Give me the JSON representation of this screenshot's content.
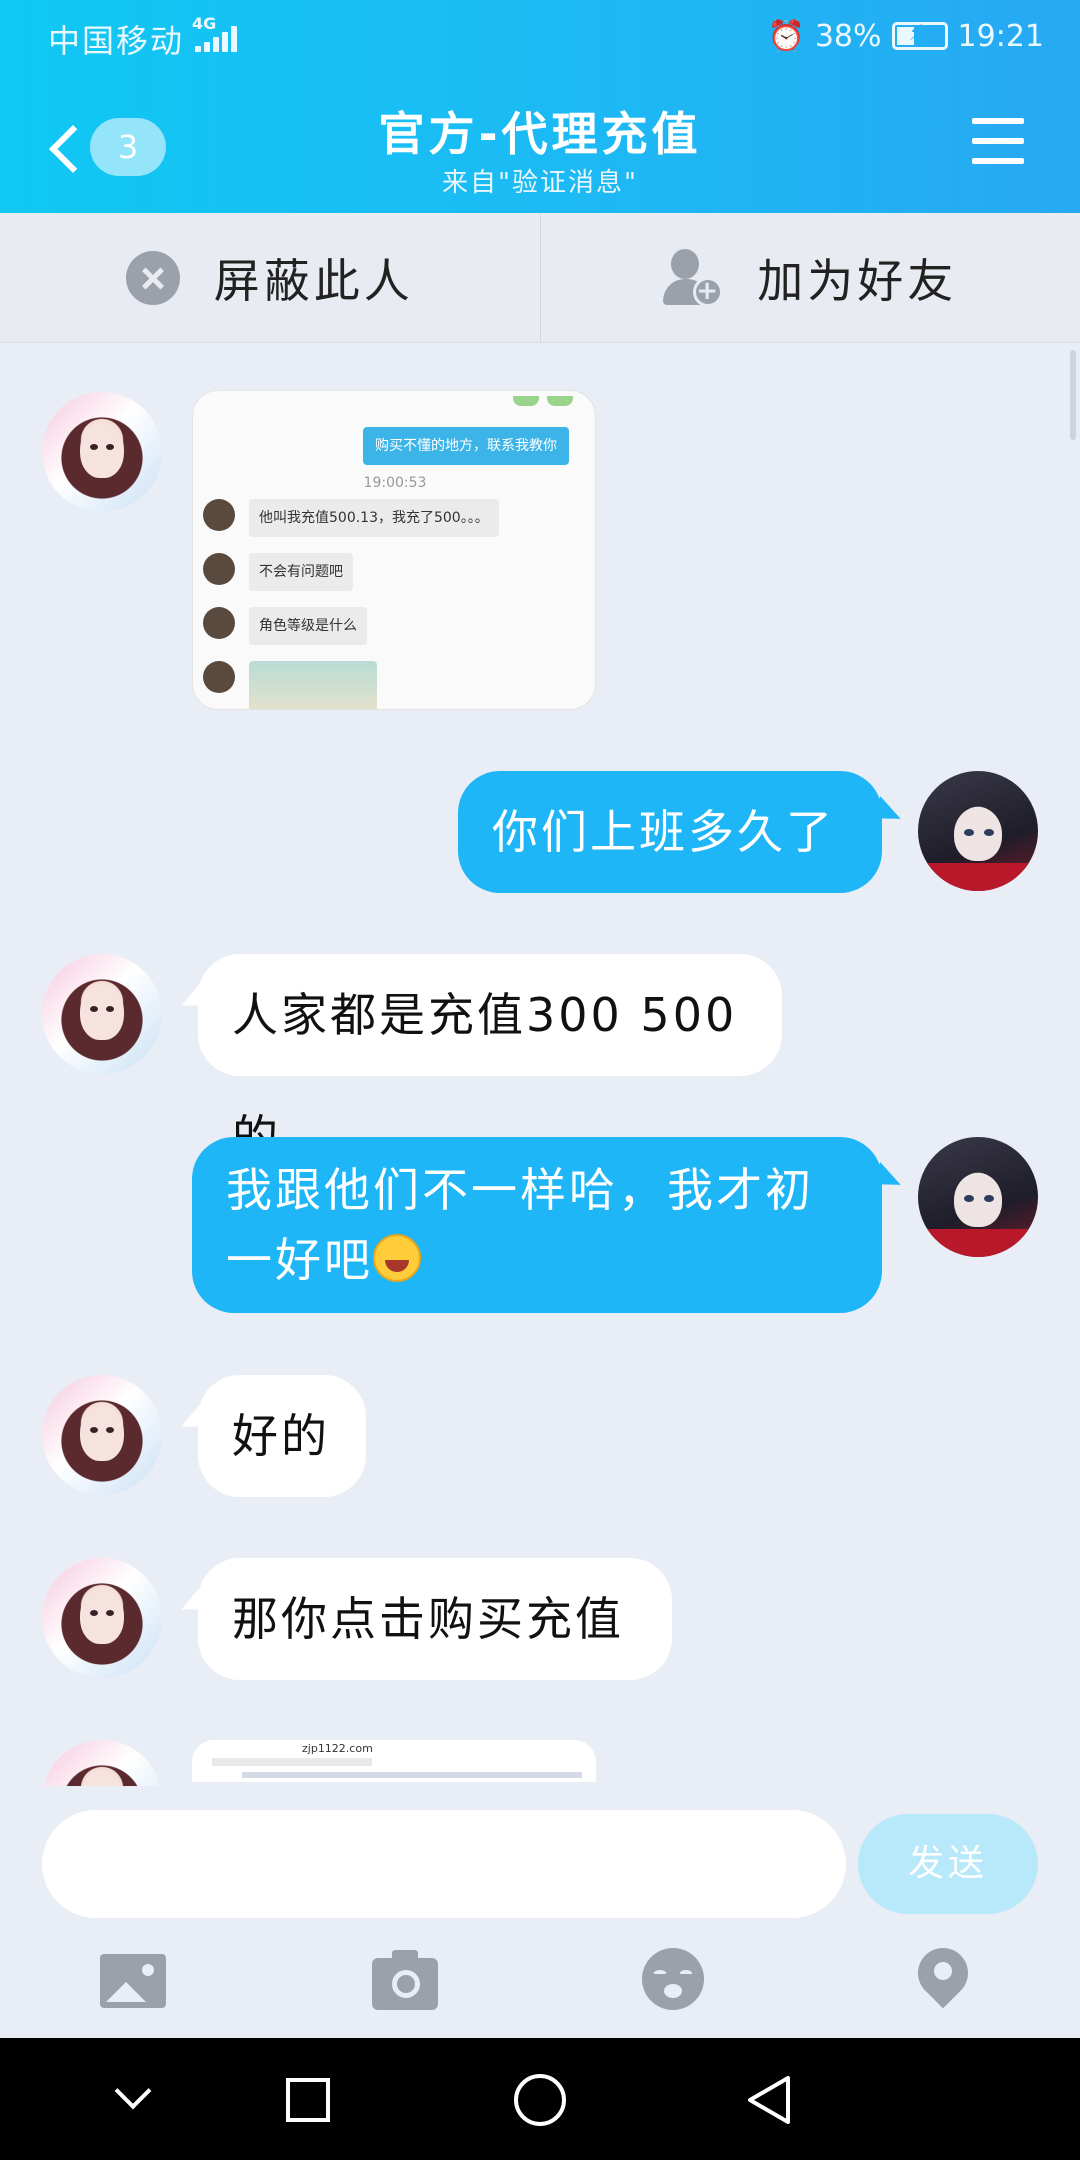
{
  "status": {
    "carrier": "中国移动",
    "network": "4G",
    "battery": "38%",
    "battery_level": 0.38,
    "time": "19:21"
  },
  "header": {
    "unread_count": "3",
    "title": "官方-代理充值",
    "subtitle": "来自\"验证消息\""
  },
  "actions": {
    "block_label": "屏蔽此人",
    "add_friend_label": "加为好友"
  },
  "image_message": {
    "top_bubble": "购买不懂的地方，联系我教你",
    "time": "19:00:53",
    "rows": [
      "他叫我充值500.13，我充了500。。。",
      "不会有问题吧",
      "角色等级是什么"
    ]
  },
  "messages": [
    {
      "side": "out",
      "text": "你们上班多久了"
    },
    {
      "side": "in",
      "text": "人家都是充值300 500的"
    },
    {
      "side": "out",
      "text": "我跟他们不一样哈，我才初一好吧"
    },
    {
      "side": "in",
      "text": "好的"
    },
    {
      "side": "in",
      "text": "那你点击购买充值"
    }
  ],
  "image_message_2": {
    "url": "zjp1122.com"
  },
  "input": {
    "value": "",
    "send_label": "发送"
  },
  "toolbar": {
    "icons": [
      "image-icon",
      "camera-icon",
      "emoji-icon",
      "location-icon"
    ]
  },
  "nav": {
    "icons": [
      "hide-keyboard-icon",
      "recent-apps-icon",
      "home-icon",
      "back-icon"
    ]
  },
  "colors": {
    "header": "#1db9f4",
    "out_bubble": "#1eb6f6",
    "in_bubble": "#ffffff",
    "send_button": "#b7e9fb"
  }
}
